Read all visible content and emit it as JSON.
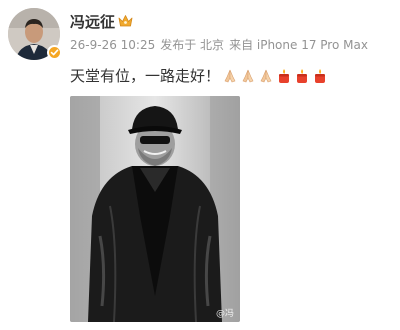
{
  "post": {
    "author_name": "冯远征",
    "timestamp": "26-9-26 10:25",
    "location": "发布于 北京",
    "source": "来自 iPhone 17 Pro Max",
    "text": "天堂有位，一路走好！",
    "emojis": [
      "praying-hands",
      "praying-hands",
      "praying-hands",
      "candle",
      "candle",
      "candle"
    ],
    "image_watermark": "@冯"
  },
  "colors": {
    "name": "#333333",
    "meta": "#939393",
    "verified": "#f5a623",
    "crown": "#f0a92e",
    "candle": "#e8412c"
  }
}
